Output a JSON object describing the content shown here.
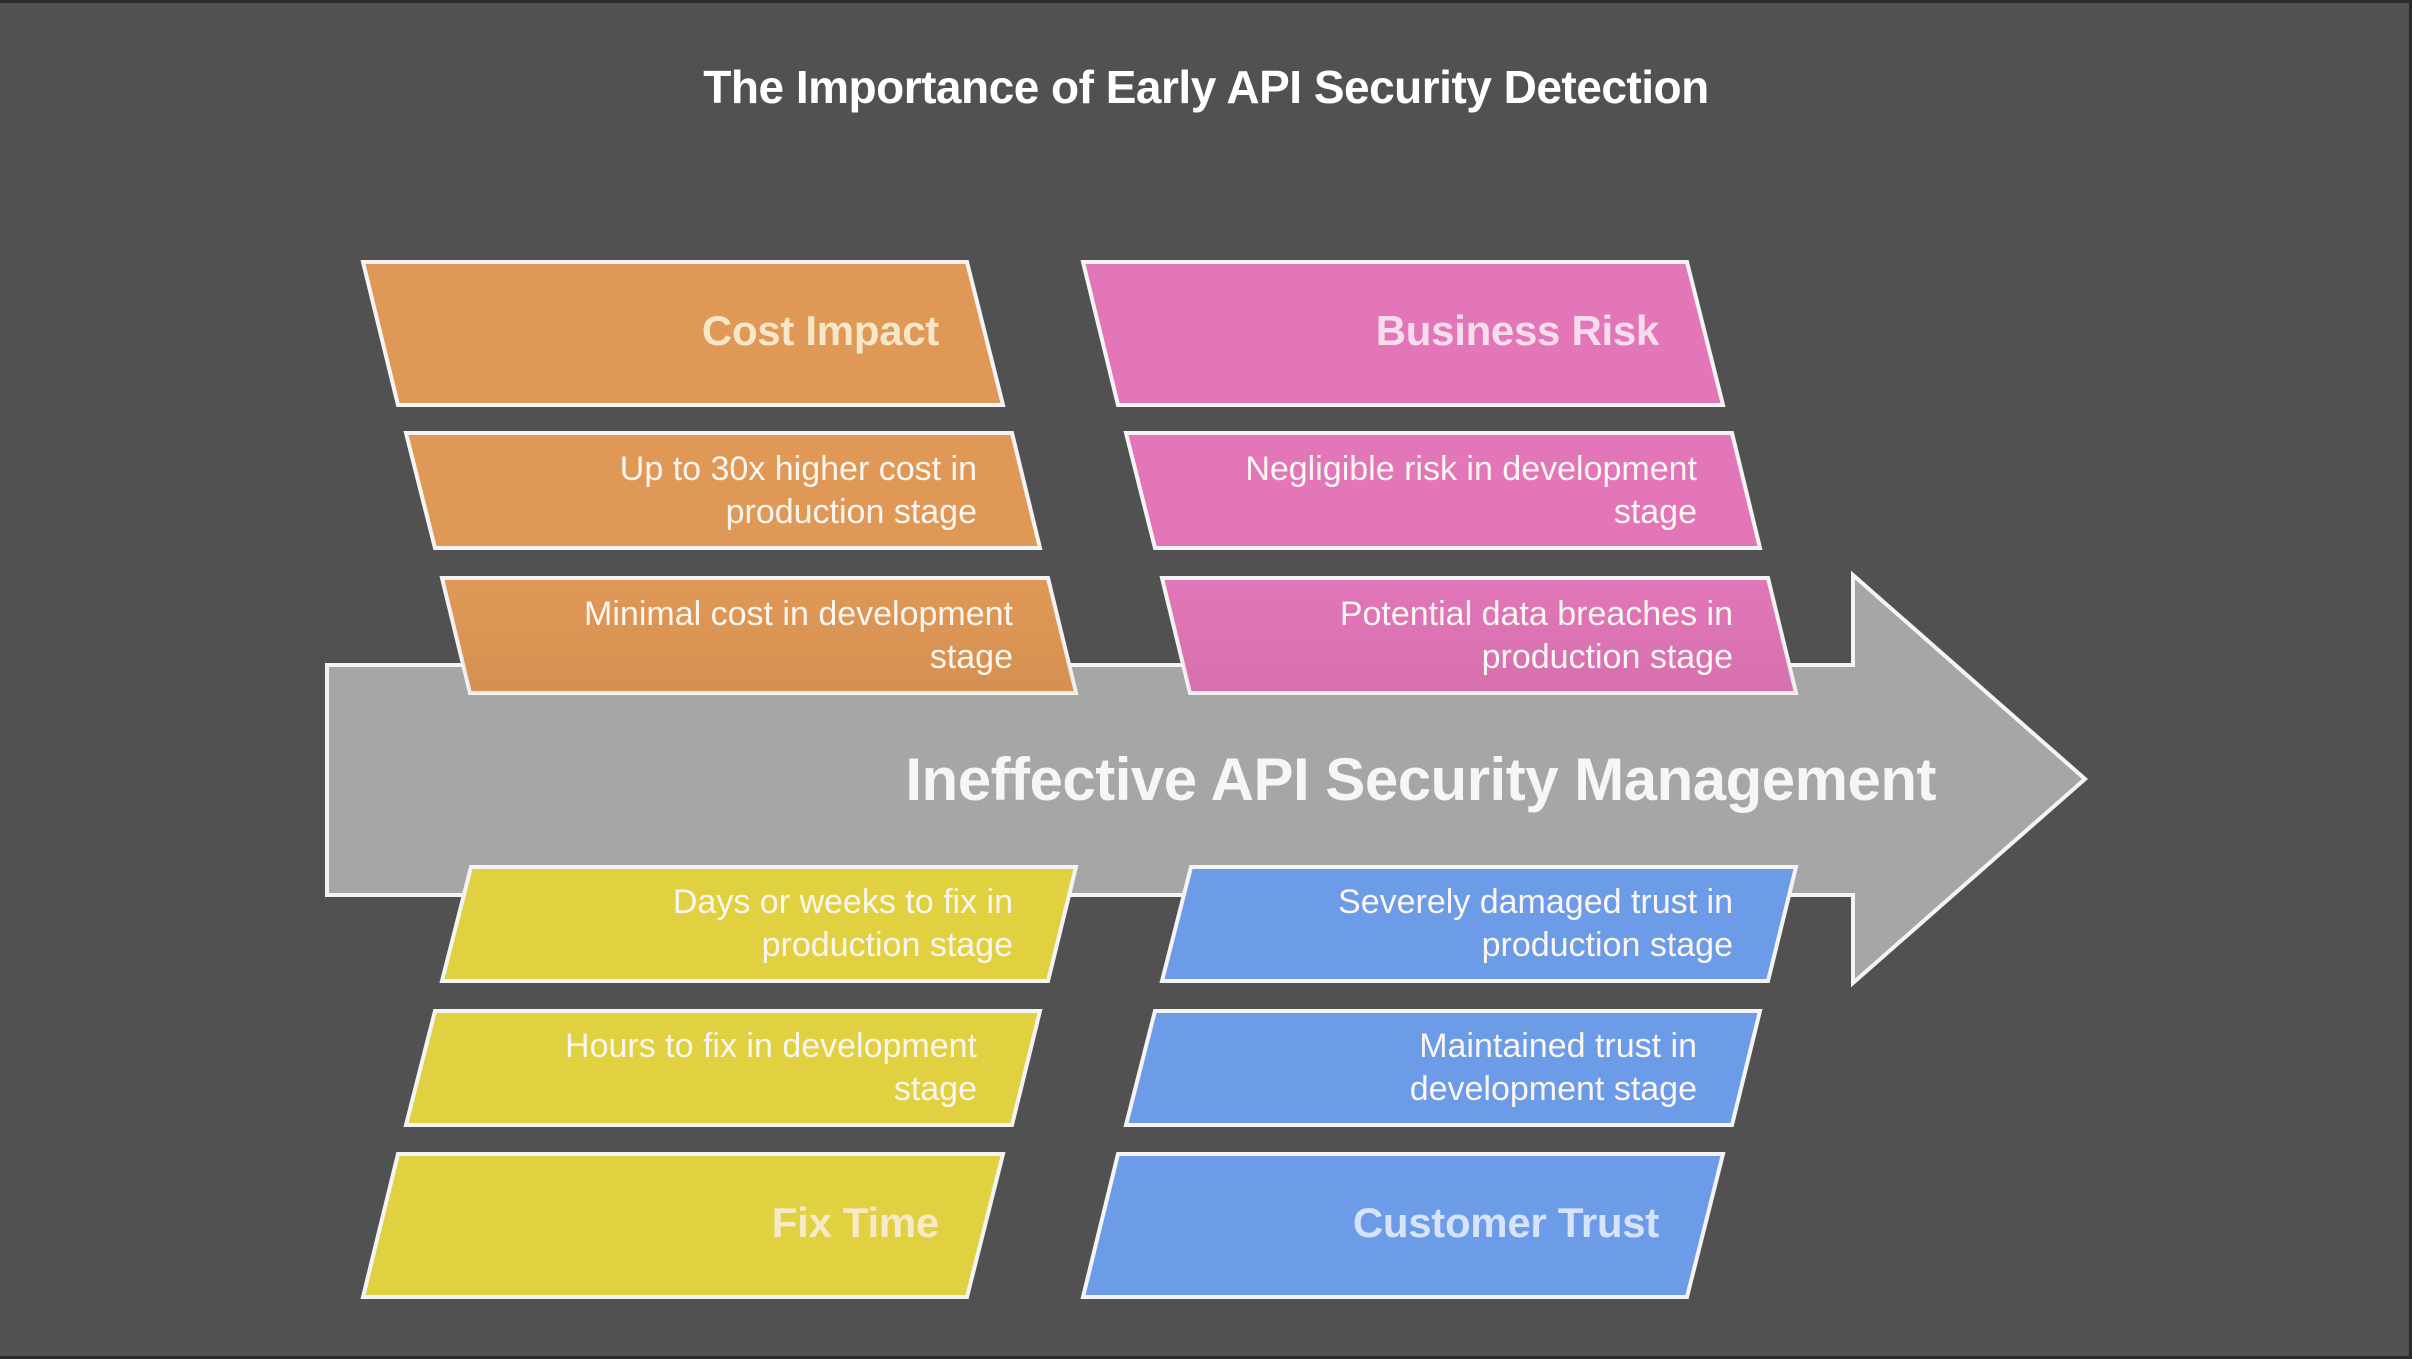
{
  "title": "The Importance of Early API Security Detection",
  "spine": {
    "label": "Ineffective API Security Management",
    "fill": "#a6a6a6",
    "stroke": "#f4f4f4"
  },
  "background": "#515151",
  "categories": [
    {
      "id": "cost-impact",
      "header": "Cost Impact",
      "position": "top-left",
      "fill": "#e09856",
      "header_color": "#f7e7c9",
      "items": [
        "Up to 30x higher cost in production stage",
        "Minimal cost in development stage"
      ]
    },
    {
      "id": "business-risk",
      "header": "Business Risk",
      "position": "top-right",
      "fill": "#e276b8",
      "header_color": "#f7dcec",
      "items": [
        "Negligible risk in development stage",
        "Potential data breaches in production stage"
      ]
    },
    {
      "id": "fix-time",
      "header": "Fix Time",
      "position": "bottom-left",
      "fill": "#e1d03f",
      "header_color": "#f6eac8",
      "items": [
        "Days or weeks to fix in production stage",
        "Hours to fix in development stage"
      ]
    },
    {
      "id": "customer-trust",
      "header": "Customer Trust",
      "position": "bottom-right",
      "fill": "#6c9be8",
      "header_color": "#d6e3f8",
      "items": [
        "Severely damaged trust in production stage",
        "Maintained trust in development stage"
      ]
    }
  ],
  "display_lines": {
    "cost-impact": [
      [
        "Up to 30x higher cost in",
        "production stage"
      ],
      [
        "Minimal cost in development",
        "stage"
      ]
    ],
    "business-risk": [
      [
        "Negligible risk in development",
        "stage"
      ],
      [
        "Potential data breaches in",
        "production stage"
      ]
    ],
    "fix-time": [
      [
        "Days or weeks to fix in",
        "production stage"
      ],
      [
        "Hours to fix in development",
        "stage"
      ]
    ],
    "customer-trust": [
      [
        "Severely damaged trust in",
        "production stage"
      ],
      [
        "Maintained trust in",
        "development stage"
      ]
    ]
  }
}
